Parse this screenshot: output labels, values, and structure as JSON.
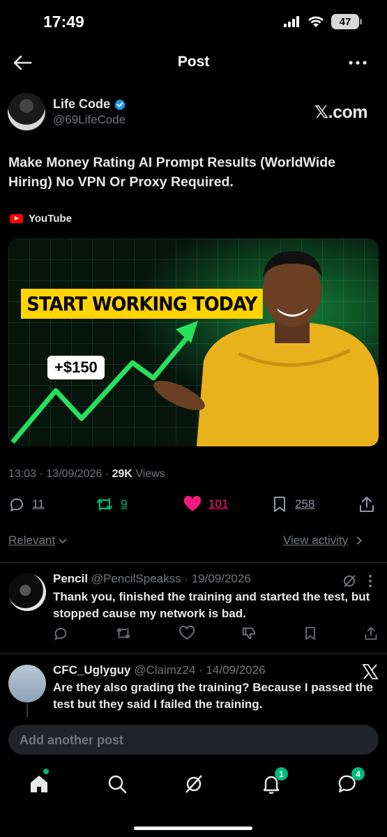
{
  "status_bar": {
    "time": "17:49",
    "battery": "47"
  },
  "header": {
    "title": "Post"
  },
  "author": {
    "name": "Life Code",
    "handle": "@69LifeCode",
    "brand": "𝕏.com"
  },
  "post": {
    "text": "Make Money Rating AI Prompt Results (WorldWide Hiring) No VPN Or Proxy Required.",
    "source": "YouTube",
    "thumbnail": {
      "banner": "START WORKING TODAY",
      "price": "+$150"
    },
    "time": "13:03",
    "date": "13/09/2026",
    "views_count": "29K",
    "views_label": "Views"
  },
  "actions": {
    "replies": "11",
    "reposts": "9",
    "likes": "101",
    "bookmarks": "258"
  },
  "filters": {
    "sort": "Relevant",
    "view_activity": "View activity"
  },
  "replies": [
    {
      "name": "Pencil",
      "handle": "@PencilSpeakss",
      "date": "· 19/09/2026",
      "text": "Thank you, finished the training and started the test, but stopped cause my network is bad."
    },
    {
      "name": "CFC_Uglyguy",
      "handle": "@Claimz24",
      "date": "· 14/09/2026",
      "text": "Are they also grading the training? Because I passed the test but they said I failed the training."
    }
  ],
  "composer": {
    "placeholder": "Add another post"
  },
  "tabbar": {
    "notifications_badge": "1",
    "messages_badge": "4"
  },
  "colors": {
    "accent_blue": "#1d9bf0",
    "repost_green": "#00ba7c",
    "like_pink": "#f91880",
    "muted": "#71767b"
  }
}
